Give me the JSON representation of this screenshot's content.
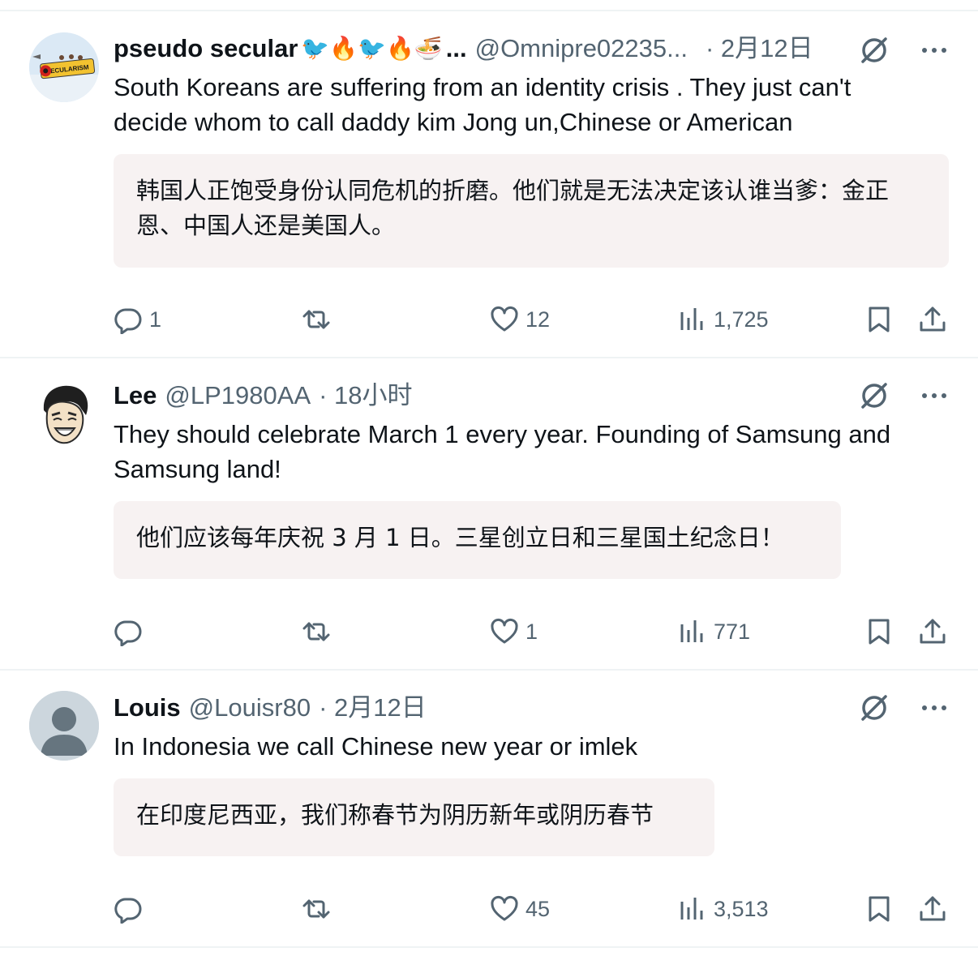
{
  "colors": {
    "text": "#0f1419",
    "secondary": "#536471",
    "translation_bg": "#f7f2f2",
    "divider": "#eff3f4"
  },
  "tweets": [
    {
      "name": "pseudo secular",
      "emojis": "🐦🔥🐦🔥🍜",
      "name_ellipsis": "...",
      "handle": "@Omnipre02235...",
      "time": "· 2月12日",
      "text": "South Koreans are suffering from an identity crisis . They just can't decide whom to call daddy kim Jong un,Chinese  or American",
      "translation": "韩国人正饱受身份认同危机的折磨。他们就是无法决定该认谁当爹：金正恩、中国人还是美国人。",
      "replies": "1",
      "reposts": "",
      "likes": "12",
      "views": "1,725",
      "avatar_banner": "SECULARISM"
    },
    {
      "name": "Lee",
      "handle": "@LP1980AA",
      "time": "· 18小时",
      "text": "They should celebrate March 1 every year. Founding of Samsung and Samsung land!",
      "translation": "他们应该每年庆祝 3 月 1 日。三星创立日和三星国土纪念日！",
      "replies": "",
      "reposts": "",
      "likes": "1",
      "views": "771"
    },
    {
      "name": "Louis",
      "handle": "@Louisr80",
      "time": "· 2月12日",
      "text": "In Indonesia we call Chinese new year or imlek",
      "translation": "在印度尼西亚，我们称春节为阴历新年或阴历春节",
      "replies": "",
      "reposts": "",
      "likes": "45",
      "views": "3,513"
    }
  ],
  "icons": {
    "grok": "grok-icon",
    "more": "more-icon",
    "reply": "reply-icon",
    "repost": "repost-icon",
    "like": "like-icon",
    "views": "views-icon",
    "bookmark": "bookmark-icon",
    "share": "share-icon"
  }
}
